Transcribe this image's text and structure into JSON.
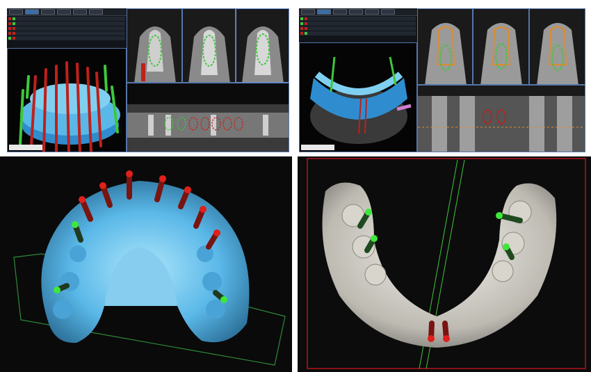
{
  "panels": {
    "top_left": {
      "tabs": [
        "",
        "",
        "",
        "",
        "",
        ""
      ],
      "viewport_text": ""
    },
    "top_right": {
      "tabs": [
        "",
        "",
        "",
        "",
        "",
        ""
      ],
      "viewport_text": ""
    }
  },
  "colors": {
    "jaw_blue": "#5ab8e8",
    "implant_red": "#c0201a",
    "implant_green": "#3ec83a",
    "bone_white": "#d9d6cf",
    "frame_red": "#b3151b",
    "panel_bg": "#000000"
  }
}
